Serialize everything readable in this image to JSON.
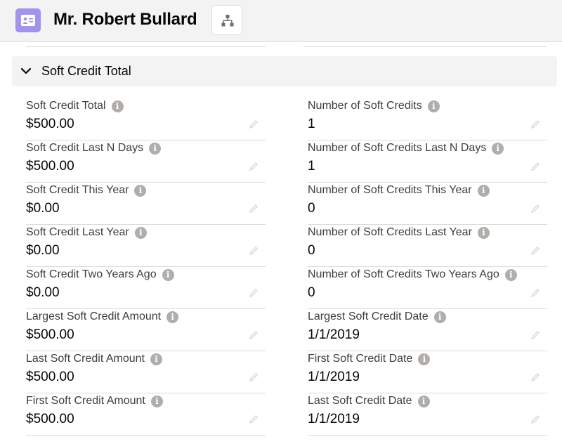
{
  "header": {
    "title": "Mr. Robert Bullard",
    "record_icon": "contact-card-icon",
    "hierarchy_icon": "hierarchy-icon"
  },
  "section": {
    "title": "Soft Credit Total",
    "toggle_icon": "chevron-down-icon"
  },
  "fields_left": [
    {
      "label": "Soft Credit Total",
      "value": "$500.00"
    },
    {
      "label": "Soft Credit Last N Days",
      "value": "$500.00"
    },
    {
      "label": "Soft Credit This Year",
      "value": "$0.00"
    },
    {
      "label": "Soft Credit Last Year",
      "value": "$0.00"
    },
    {
      "label": "Soft Credit Two Years Ago",
      "value": "$0.00"
    },
    {
      "label": "Largest Soft Credit Amount",
      "value": "$500.00"
    },
    {
      "label": "Last Soft Credit Amount",
      "value": "$500.00"
    },
    {
      "label": "First Soft Credit Amount",
      "value": "$500.00"
    }
  ],
  "fields_right": [
    {
      "label": "Number of Soft Credits",
      "value": "1"
    },
    {
      "label": "Number of Soft Credits Last N Days",
      "value": "1"
    },
    {
      "label": "Number of Soft Credits This Year",
      "value": "0"
    },
    {
      "label": "Number of Soft Credits Last Year",
      "value": "0"
    },
    {
      "label": "Number of Soft Credits Two Years Ago",
      "value": "0"
    },
    {
      "label": "Largest Soft Credit Date",
      "value": "1/1/2019"
    },
    {
      "label": "First Soft Credit Date",
      "value": "1/1/2019"
    },
    {
      "label": "Last Soft Credit Date",
      "value": "1/1/2019"
    }
  ],
  "info_glyph": "i",
  "colors": {
    "record_icon_bg": "#a094ed",
    "header_bg": "#f3f3f3",
    "divider": "#dddbda",
    "info_icon": "#b0adab"
  }
}
